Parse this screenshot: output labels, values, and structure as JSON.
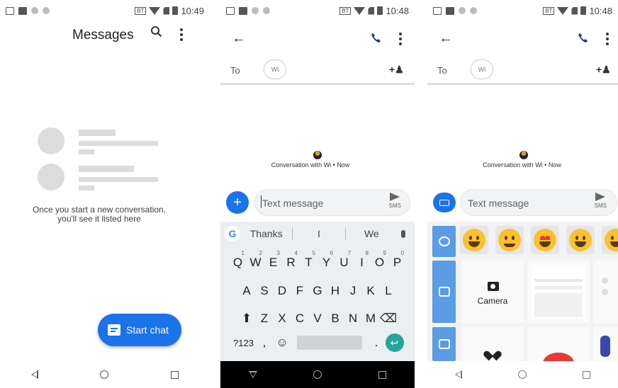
{
  "status": {
    "screen1_time": "10:49",
    "screen2_time": "10:48",
    "screen3_time": "10:48",
    "bt_label": "BT"
  },
  "screen1": {
    "title": "Messages",
    "empty_state": "Once you start a new conversation, you'll see it listed here",
    "start_chat_label": "Start chat"
  },
  "conversation": {
    "to_label": "To",
    "recipient_chip": "Wi",
    "conversation_label": "Conversation with Wi • Now",
    "compose_placeholder": "Text message",
    "send_label": "SMS"
  },
  "keyboard": {
    "g_label": "G",
    "suggestions": [
      "Thanks",
      "I",
      "We"
    ],
    "row1": [
      "Q",
      "W",
      "E",
      "R",
      "T",
      "Y",
      "U",
      "I",
      "O",
      "P"
    ],
    "row1_hints": [
      "1",
      "2",
      "3",
      "4",
      "5",
      "6",
      "7",
      "8",
      "9",
      "0"
    ],
    "row2": [
      "A",
      "S",
      "D",
      "F",
      "G",
      "H",
      "J",
      "K",
      "L"
    ],
    "row3": [
      "Z",
      "X",
      "C",
      "V",
      "B",
      "N",
      "M"
    ],
    "symbols_key": "?123",
    "comma_key": ",",
    "period_key": "."
  },
  "attach_panel": {
    "camera_label": "Camera"
  },
  "colors": {
    "accent": "#1a73e8",
    "enter_key": "#26a69a"
  }
}
